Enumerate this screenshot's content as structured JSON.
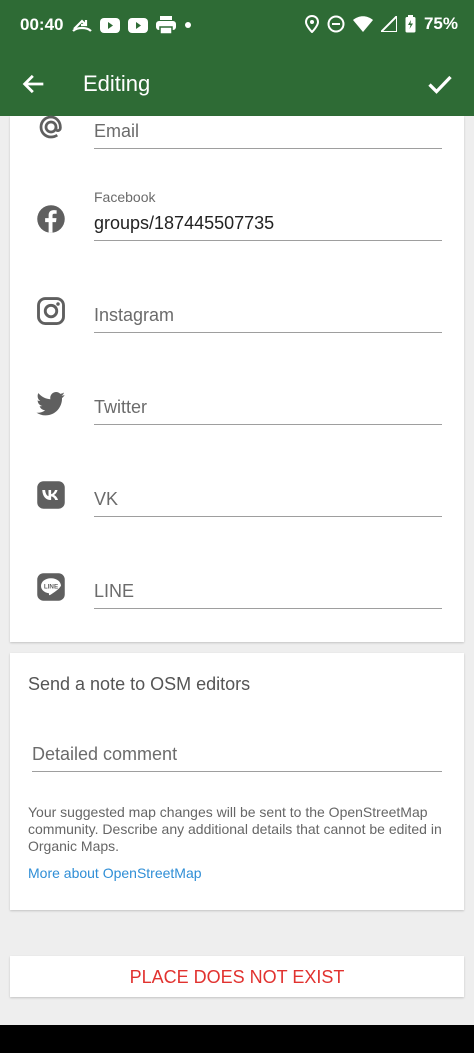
{
  "status_bar": {
    "time": "00:40",
    "battery": "75%",
    "icons": [
      "missed-call-icon",
      "youtube-icon",
      "youtube-icon",
      "printer-icon",
      "dot-icon",
      "location-icon",
      "dnd-icon",
      "wifi-icon",
      "signal-icon",
      "battery-icon"
    ]
  },
  "toolbar": {
    "title": "Editing"
  },
  "contacts": {
    "email": {
      "icon": "at-icon",
      "placeholder": "Email"
    },
    "facebook": {
      "icon": "facebook-icon",
      "label": "Facebook",
      "value": "groups/187445507735"
    },
    "instagram": {
      "icon": "instagram-icon",
      "placeholder": "Instagram"
    },
    "twitter": {
      "icon": "twitter-icon",
      "placeholder": "Twitter"
    },
    "vk": {
      "icon": "vk-icon",
      "placeholder": "VK"
    },
    "line": {
      "icon": "line-icon",
      "placeholder": "LINE"
    }
  },
  "note": {
    "title": "Send a note to OSM editors",
    "comment_placeholder": "Detailed comment",
    "disclaimer": "Your suggested map changes will be sent to the OpenStreetMap community. Describe any additional details that cannot be edited in Organic Maps.",
    "link": "More about OpenStreetMap"
  },
  "place_not_exist": "PLACE DOES NOT EXIST",
  "colors": {
    "toolbar_bg": "#2e6b35",
    "link": "#2f8ed6",
    "danger": "#e1322f"
  }
}
